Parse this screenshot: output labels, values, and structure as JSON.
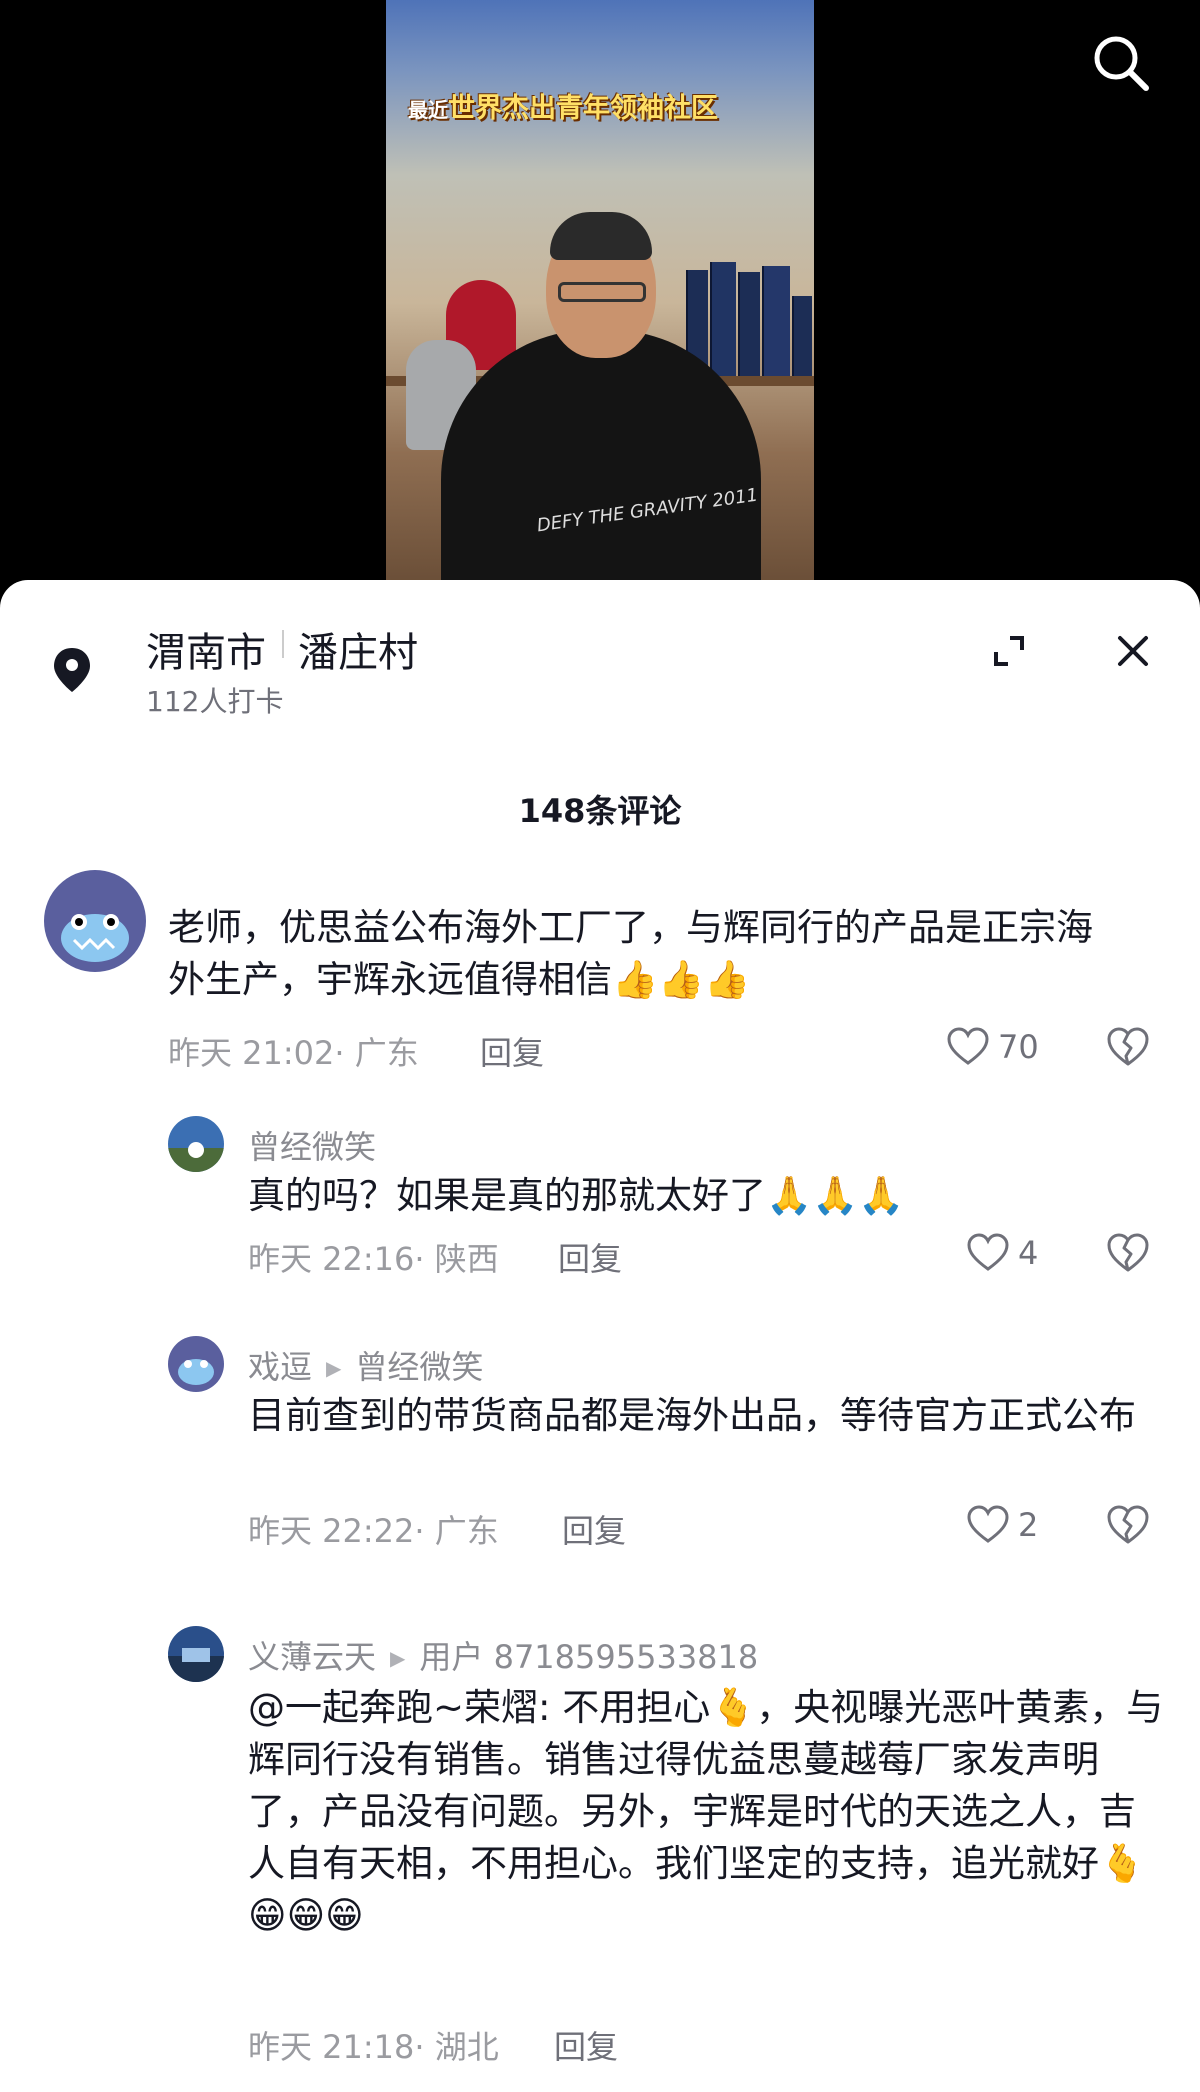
{
  "video": {
    "caption_prefix": "最近",
    "caption": "世界杰出青年领袖社区",
    "shirt_text": "DEFY THE GRAVITY 2011"
  },
  "location": {
    "city": "渭南市",
    "village": "潘庄村",
    "checkins": "112人打卡"
  },
  "comments_title": "148条评论",
  "comments": [
    {
      "text": "老师，优思益公布海外工厂了，与辉同行的产品是正宗海外生产，宇辉永远值得相信👍👍👍",
      "meta": "昨天 21:02· 广东",
      "reply": "回复",
      "likes": "70"
    },
    {
      "author": "曾经微笑",
      "text": "真的吗？如果是真的那就太好了🙏🙏🙏",
      "meta": "昨天 22:16· 陕西",
      "reply": "回复",
      "likes": "4"
    },
    {
      "author": "戏逗",
      "reply_to": "曾经微笑",
      "text": "目前查到的带货商品都是海外出品，等待官方正式公布",
      "meta": "昨天 22:22· 广东",
      "reply": "回复",
      "likes": "2"
    },
    {
      "author": "义薄云天",
      "reply_to": "用户 8718595533818",
      "text": "@一起奔跑~荣熠: 不用担心🫰，央视曝光恶叶黄素，与辉同行没有销售。销售过得优益思蔓越莓厂家发声明了，产品没有问题。另外，宇辉是时代的天选之人，吉人自有天相，不用担心。我们坚定的支持，追光就好🫰😁😁😁",
      "meta": "昨天 21:18· 湖北",
      "reply": "回复"
    }
  ],
  "colors": {
    "text": "#161823",
    "secondary": "#8a8b91",
    "sheet_bg": "#ffffff"
  },
  "icons": [
    "search-icon",
    "location-pin-icon",
    "expand-icon",
    "close-icon",
    "heart-icon",
    "broken-heart-icon"
  ]
}
